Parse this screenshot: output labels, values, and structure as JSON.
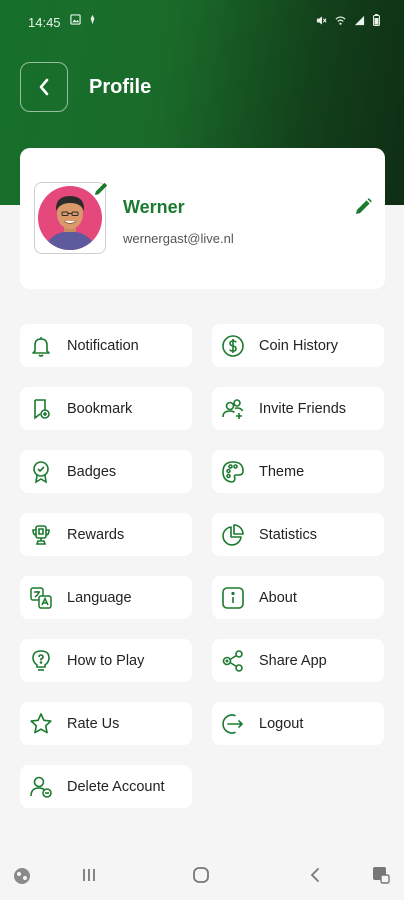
{
  "status_bar": {
    "time": "14:45"
  },
  "header": {
    "title": "Profile"
  },
  "profile": {
    "name": "Werner",
    "email": "wernergast@live.nl"
  },
  "menu": {
    "left": [
      {
        "label": "Notification",
        "icon": "bell-icon"
      },
      {
        "label": "Bookmark",
        "icon": "bookmark-icon"
      },
      {
        "label": "Badges",
        "icon": "badge-icon"
      },
      {
        "label": "Rewards",
        "icon": "reward-icon"
      },
      {
        "label": "Language",
        "icon": "language-icon"
      },
      {
        "label": "How to Play",
        "icon": "lightbulb-question-icon"
      },
      {
        "label": "Rate Us",
        "icon": "star-icon"
      },
      {
        "label": "Delete Account",
        "icon": "user-delete-icon"
      }
    ],
    "right": [
      {
        "label": "Coin History",
        "icon": "coin-icon"
      },
      {
        "label": "Invite Friends",
        "icon": "invite-friends-icon"
      },
      {
        "label": "Theme",
        "icon": "palette-icon"
      },
      {
        "label": "Statistics",
        "icon": "pie-chart-icon"
      },
      {
        "label": "About",
        "icon": "info-icon"
      },
      {
        "label": "Share App",
        "icon": "share-icon"
      },
      {
        "label": "Logout",
        "icon": "logout-icon"
      }
    ]
  },
  "colors": {
    "accent": "#1b7a2e",
    "header_start": "#16702a",
    "header_end": "#0f2d14"
  }
}
